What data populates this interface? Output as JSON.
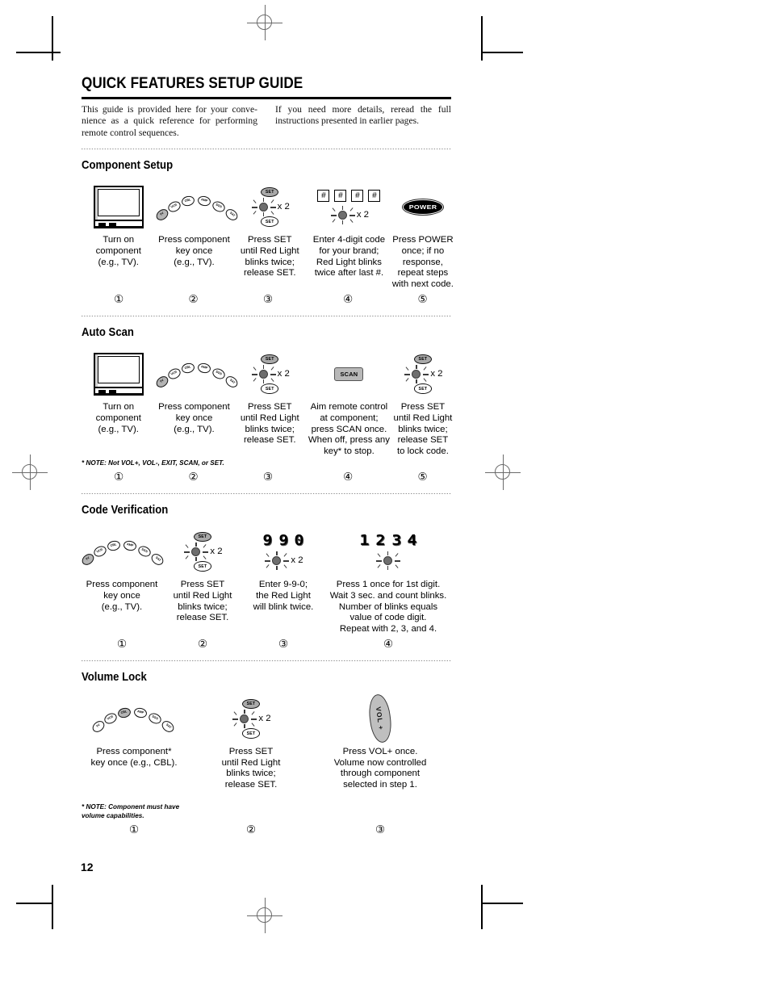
{
  "document": {
    "page_number": "12",
    "title": "QUICK FEATURES SETUP GUIDE",
    "intro_left": "This guide is provided here for your conve-nience as a quick reference for performing remote control sequences.",
    "intro_right": "If you need more details, reread the full instructions presented in earlier pages."
  },
  "component_keys": {
    "labels": [
      "TV",
      "VCR",
      "CBL",
      "AMP",
      "DSS",
      "SAT"
    ],
    "short": [
      "TV",
      "VCR",
      "CBL",
      "AMP",
      "DSS",
      "SAT"
    ]
  },
  "sections": [
    {
      "id": "component-setup",
      "title": "Component Setup",
      "note": "",
      "steps": [
        {
          "number": "①",
          "art": "tv",
          "caption": "Turn on\ncomponent\n(e.g., TV)."
        },
        {
          "number": "②",
          "art": "component-arc",
          "highlight": 0,
          "caption": "Press component\nkey once\n(e.g., TV)."
        },
        {
          "number": "③",
          "art": "set-blink-set",
          "blink_label": "x 2",
          "set_label": "SET",
          "caption": "Press SET\nuntil Red Light\nblinks twice;\nrelease SET."
        },
        {
          "number": "④",
          "art": "hash-blink",
          "hash_label": "#",
          "hash_count": 4,
          "blink_label": "x 2",
          "caption": "Enter 4-digit code\nfor your brand;\nRed Light blinks\ntwice after last #."
        },
        {
          "number": "⑤",
          "art": "power",
          "power_label": "POWER",
          "caption": "Press POWER\nonce; if no\nresponse,\nrepeat steps\nwith next code."
        }
      ]
    },
    {
      "id": "auto-scan",
      "title": "Auto Scan",
      "note": "* NOTE: Not VOL+, VOL-, EXIT, SCAN, or SET.",
      "steps": [
        {
          "number": "①",
          "art": "tv",
          "caption": "Turn on\ncomponent\n(e.g., TV)."
        },
        {
          "number": "②",
          "art": "component-arc",
          "highlight": 0,
          "caption": "Press component\nkey once\n(e.g., TV)."
        },
        {
          "number": "③",
          "art": "set-blink-set",
          "blink_label": "x 2",
          "set_label": "SET",
          "caption": "Press SET\nuntil Red Light\nblinks twice;\nrelease SET."
        },
        {
          "number": "④",
          "art": "scan",
          "scan_label": "SCAN",
          "caption": "Aim remote control\nat component;\npress SCAN once.\nWhen off, press any\nkey* to stop."
        },
        {
          "number": "⑤",
          "art": "set-blink-set",
          "blink_label": "x 2",
          "set_label": "SET",
          "caption": "Press SET\nuntil Red Light\nblinks twice;\nrelease SET\nto lock code."
        }
      ]
    },
    {
      "id": "code-verification",
      "title": "Code Verification",
      "note": "",
      "steps": [
        {
          "number": "①",
          "art": "component-arc",
          "highlight": 0,
          "caption": "Press component\nkey once\n(e.g., TV)."
        },
        {
          "number": "②",
          "art": "set-blink-set",
          "blink_label": "x 2",
          "set_label": "SET",
          "caption": "Press SET\nuntil Red Light\nblinks twice;\nrelease SET."
        },
        {
          "number": "③",
          "art": "digits-blink",
          "digits": [
            "9",
            "9",
            "0"
          ],
          "blink_label": "x 2",
          "caption": "Enter 9-9-0;\nthe Red Light\nwill blink twice."
        },
        {
          "number": "④",
          "art": "digits-blink-plain",
          "digits": [
            "1",
            "2",
            "3",
            "4"
          ],
          "blink_label": "",
          "caption": "Press 1 once for 1st digit.\nWait 3 sec. and count blinks.\nNumber of blinks equals\nvalue of code digit.\nRepeat with 2, 3, and 4."
        }
      ]
    },
    {
      "id": "volume-lock",
      "title": "Volume Lock",
      "note": "* NOTE: Component must have\n   volume capabilities.",
      "steps": [
        {
          "number": "①",
          "art": "component-arc",
          "highlight": 2,
          "caption": "Press component*\nkey once (e.g., CBL)."
        },
        {
          "number": "②",
          "art": "set-blink-set",
          "blink_label": "x 2",
          "set_label": "SET",
          "caption": "Press SET\nuntil Red Light\nblinks twice;\nrelease SET."
        },
        {
          "number": "③",
          "art": "vol-key",
          "vol_label": "VOL +",
          "caption": "Press VOL+ once.\nVolume now controlled\nthrough component\nselected in step 1."
        }
      ]
    }
  ]
}
